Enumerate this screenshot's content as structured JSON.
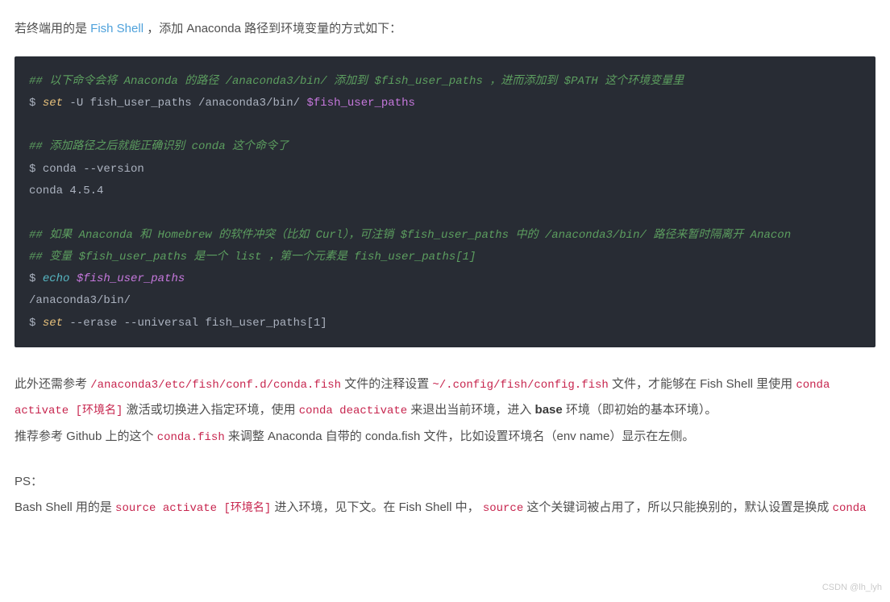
{
  "intro": {
    "pre": "若终端用的是 ",
    "link": "Fish Shell",
    "post": " ，添加 Anaconda 路径到环境变量的方式如下：",
    "link_href": "#"
  },
  "code": {
    "c1": "## 以下命令会将 Anaconda 的路径 /anaconda3/bin/ 添加到 $fish_user_paths ，进而添加到 $PATH 这个环境变量里",
    "l1_prompt": "$ ",
    "l1_set": "set",
    "l1_args": " -U fish_user_paths /anaconda3/bin/ ",
    "l1_var": "$fish_user_paths",
    "c2": "## 添加路径之后就能正确识别 conda 这个命令了",
    "l2_prompt": "$ ",
    "l2_cmd": "conda --version",
    "l2_out": "conda 4.5.4",
    "c3": "## 如果 Anaconda 和 Homebrew 的软件冲突（比如 Curl），可注销 $fish_user_paths 中的 /anaconda3/bin/ 路径来暂时隔离开 Anacon",
    "c4": "## 变量 $fish_user_paths 是一个 list ，第一个元素是 fish_user_paths[1]",
    "l3_prompt": "$ ",
    "l3_echo": "echo",
    "l3_sp": " ",
    "l3_var": "$fish_user_paths",
    "l3_out": "/anaconda3/bin/",
    "l4_prompt": "$ ",
    "l4_set": "set",
    "l4_args": " --erase --universal fish_user_paths[1]"
  },
  "para1": {
    "t1": "此外还需参考 ",
    "code1": "/anaconda3/etc/fish/conf.d/conda.fish",
    "t2": " 文件的注释设置 ",
    "code2": "~/.config/fish/config.fish",
    "t3": " 文件，才能够在 Fish Shell 里使用 ",
    "code3": "conda activate [环境名]",
    "t4": " 激活或切换进入指定环境，使用 ",
    "code4": "conda deactivate",
    "t5": " 来退出当前环境，进入 ",
    "bold": "base",
    "t6": " 环境（即初始的基本环境）。"
  },
  "para2": {
    "t1": "推荐参考 Github 上的这个 ",
    "code1": "conda.fish",
    "t2": " 来调整 Anaconda 自带的 conda.fish 文件，比如设置环境名（env name）显示在左侧。"
  },
  "para3": {
    "t1": "PS："
  },
  "para4": {
    "t1": "Bash Shell 用的是 ",
    "code1": "source activate [环境名]",
    "t2": " 进入环境，见下文。在 Fish Shell 中， ",
    "code2": "source",
    "t3": " 这个关键词被占用了，所以只能换别的，默认设置是换成 ",
    "code3": "conda"
  },
  "footer": "CSDN @lh_lyh"
}
